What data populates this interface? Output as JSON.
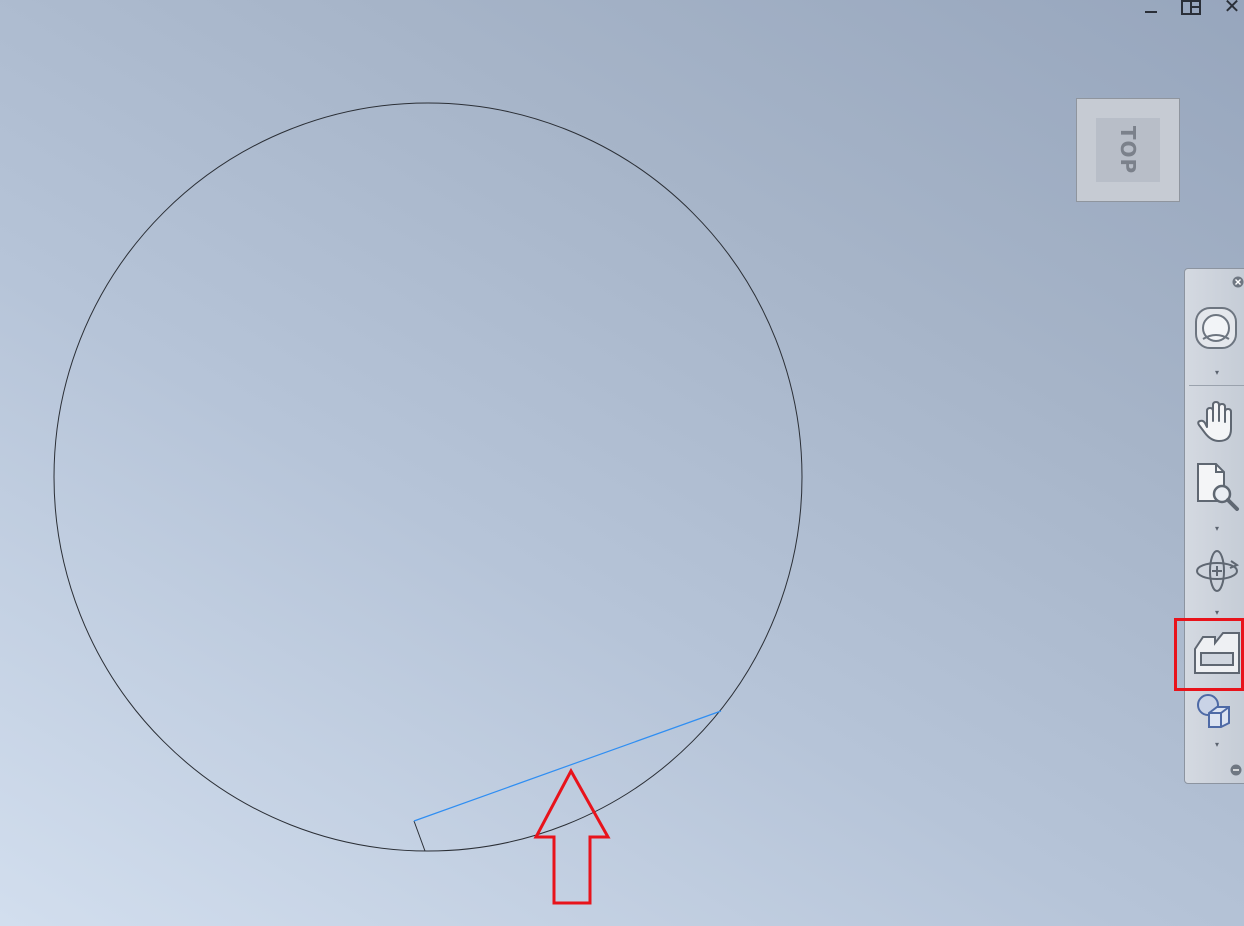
{
  "window_controls": {
    "minimize_icon": "minimize-icon",
    "restore_icon": "restore-icon",
    "close_label": "✕"
  },
  "viewcube": {
    "face_label": "TOP"
  },
  "navigation_bar": {
    "tools": [
      "steering-wheel-icon",
      "pan-hand-icon",
      "zoom-page-icon",
      "orbit-icon",
      "section-view-icon",
      "shapes-display-icon"
    ],
    "colors": {
      "sketch_line": "#2b2f36",
      "selected_line": "#2f8ef2",
      "annotation": "#e8131b"
    }
  }
}
